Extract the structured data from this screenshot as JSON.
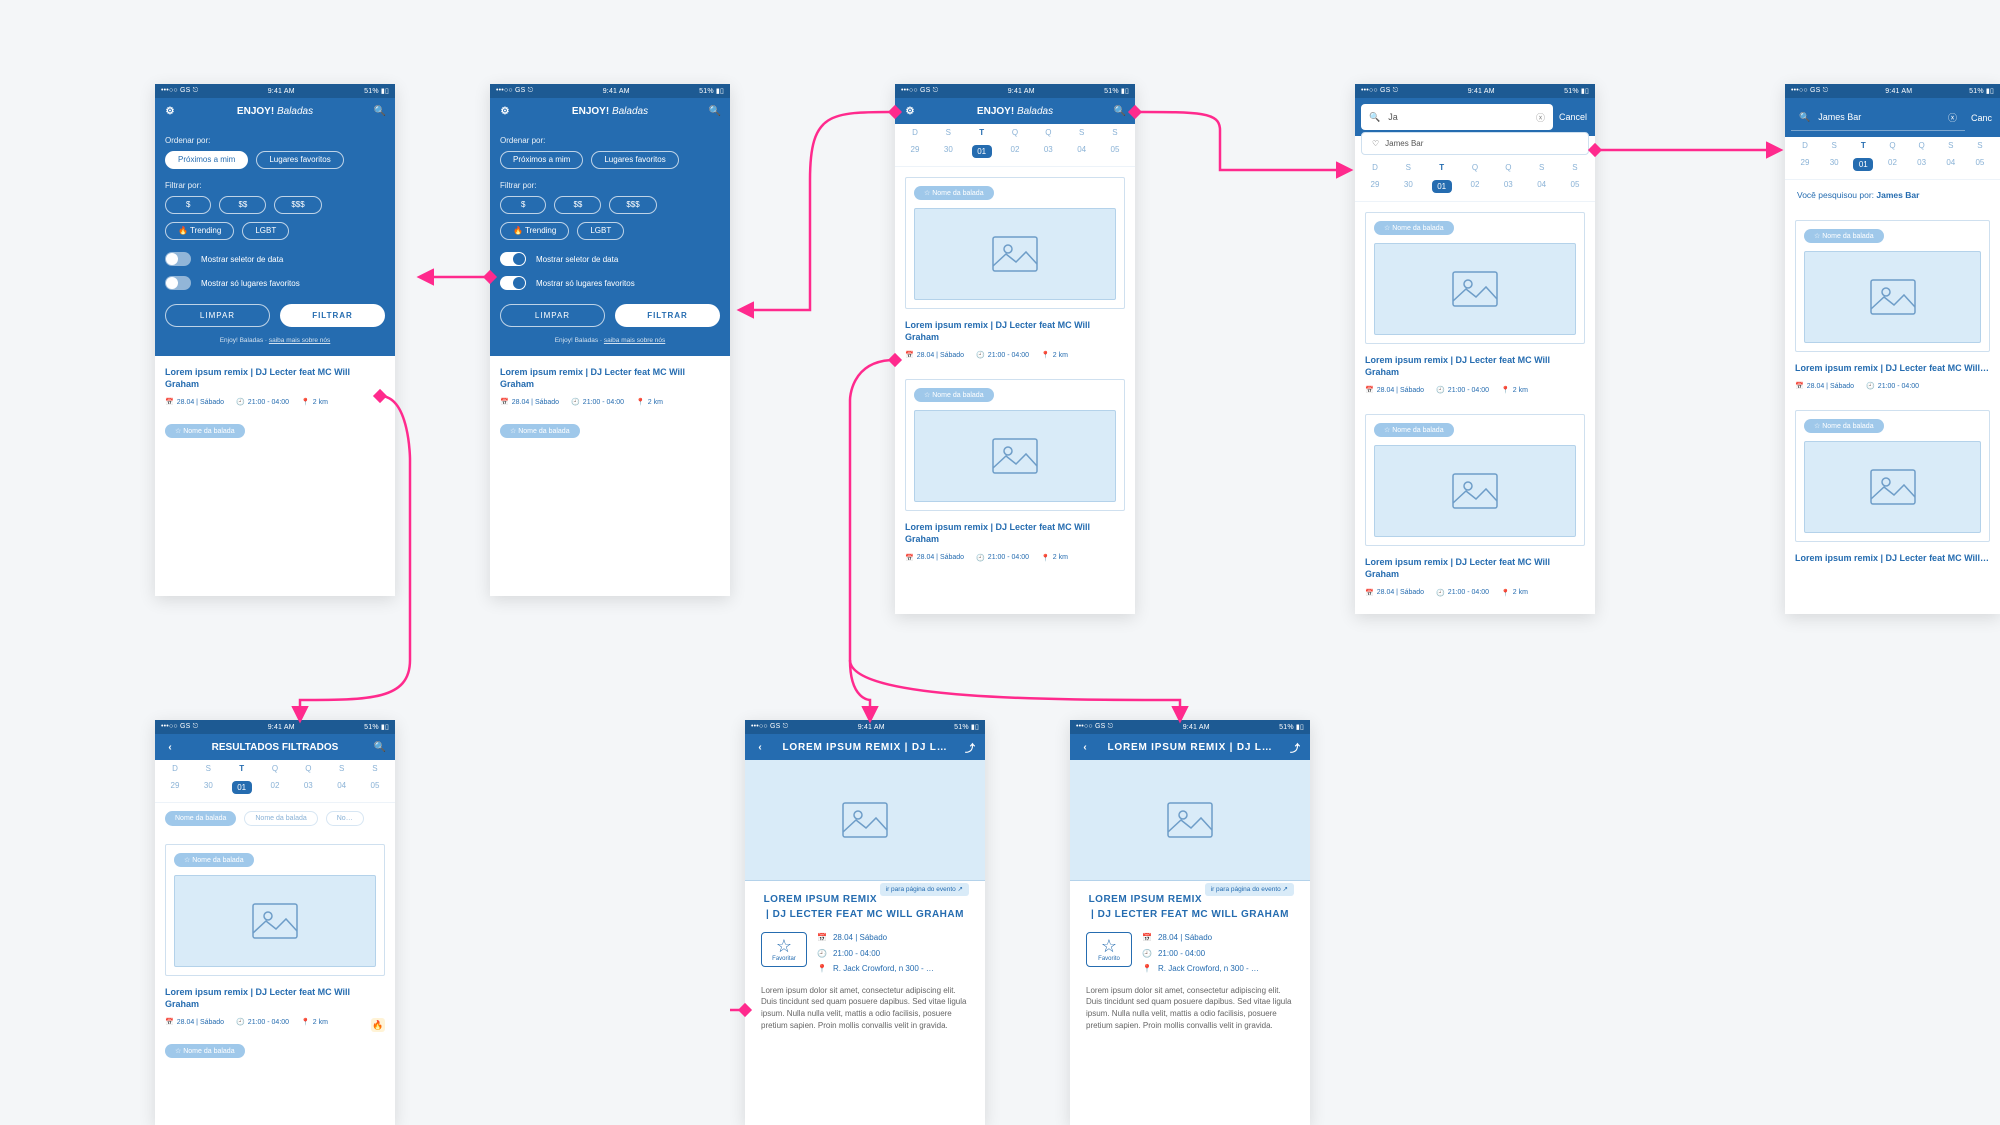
{
  "status": {
    "left": "•••○○ GS ⎋",
    "time": "9:41 AM",
    "right": "51% ▮▯"
  },
  "app": {
    "brand": "ENJOY!",
    "section": "Baladas"
  },
  "filter": {
    "order_label": "Ordenar por:",
    "order_opts": [
      "Próximos a mim",
      "Lugares favoritos"
    ],
    "filter_label": "Filtrar por:",
    "price_opts": [
      "$",
      "$$",
      "$$$"
    ],
    "tag_opts": [
      "🔥 Trending",
      "LGBT"
    ],
    "toggle1": "Mostrar seletor de data",
    "toggle2": "Mostrar só lugares favoritos",
    "btn_clear": "LIMPAR",
    "btn_apply": "FILTRAR",
    "footnote_pre": "Enjoy! Baladas · ",
    "footnote_link": "saiba mais sobre nós"
  },
  "cal": {
    "days": [
      "D",
      "S",
      "T",
      "Q",
      "Q",
      "S",
      "S"
    ],
    "nums": [
      "29",
      "30",
      "01",
      "02",
      "03",
      "04",
      "05"
    ],
    "sel": 2
  },
  "event": {
    "chip": "☆ Nome da balada",
    "title": "Lorem ipsum remix | DJ Lecter feat MC Will Graham",
    "title_short": "Lorem ipsum remix | DJ Lecter feat MC Will…",
    "date": "28.04 | Sábado",
    "time": "21:00 - 04:00",
    "dist": "2 km"
  },
  "results": {
    "title": "RESULTADOS FILTRADOS",
    "tags": [
      "Nome da balada",
      "Nome da balada",
      "No…"
    ]
  },
  "search": {
    "placeholder": "Ja",
    "full": "James Bar",
    "cancel": "Cancel",
    "suggest": "James Bar",
    "resline_pre": "Você pesquisou por: ",
    "resline_term": "James Bar"
  },
  "detail": {
    "nav": "LOREM IPSUM REMIX | DJ L…",
    "title": "LOREM IPSUM REMIX | DJ LECTER FEAT MC WILL GRAHAM",
    "date": "28.04 | Sábado",
    "time": "21:00 - 04:00",
    "addr": "R. Jack Crowford, n 300 - …",
    "fav": "Favoritar",
    "fav2": "Favorito",
    "link": "ir para página do evento ↗",
    "body": "Lorem ipsum dolor sit amet, consectetur adipiscing elit. Duis tincidunt sed quam posuere dapibus. Sed vitae ligula ipsum. Nulla nulla velit, mattis a odio facilisis, posuere pretium sapien. Proin mollis convallis velit in gravida."
  }
}
